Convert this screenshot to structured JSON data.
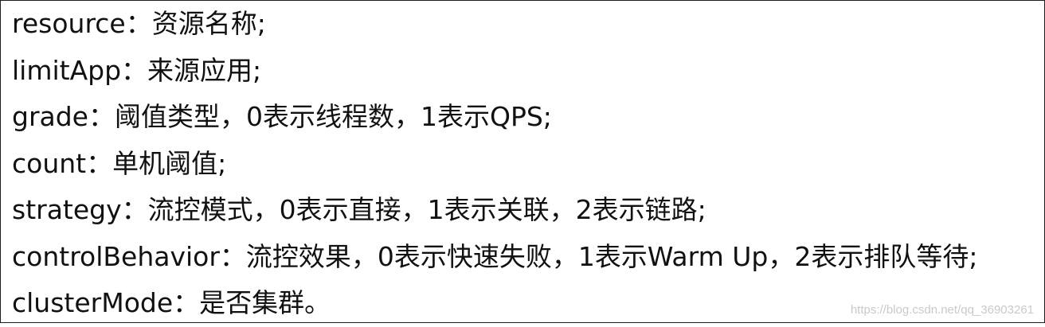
{
  "lines": [
    "resource：资源名称;",
    "limitApp：来源应用;",
    "grade：阈值类型，0表示线程数，1表示QPS;",
    "count：单机阈值;",
    "strategy：流控模式，0表示直接，1表示关联，2表示链路;",
    "controlBehavior：流控效果，0表示快速失败，1表示Warm Up，2表示排队等待;",
    "clusterMode：是否集群。"
  ],
  "watermark": "https://blog.csdn.net/qq_36903261"
}
